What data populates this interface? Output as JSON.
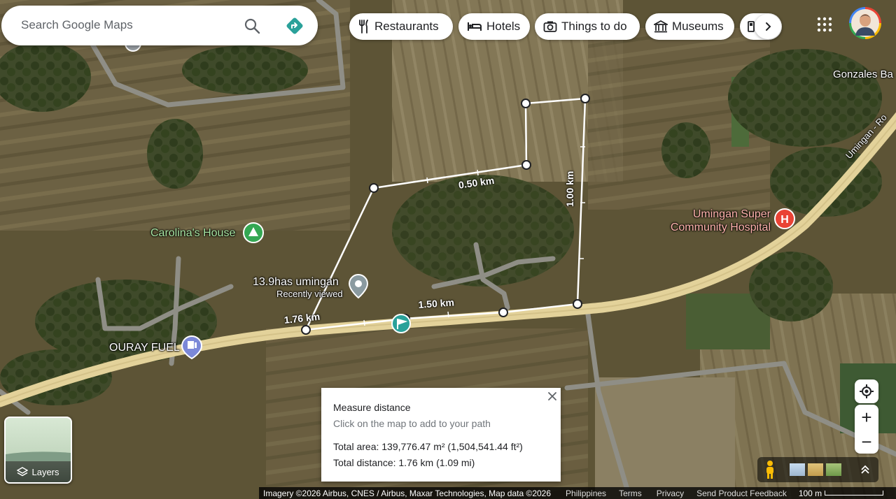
{
  "search": {
    "placeholder": "Search Google Maps"
  },
  "categories": [
    {
      "label": "Restaurants",
      "icon": "fork-knife-icon"
    },
    {
      "label": "Hotels",
      "icon": "bed-icon"
    },
    {
      "label": "Things to do",
      "icon": "camera-icon"
    },
    {
      "label": "Museums",
      "icon": "museum-icon"
    }
  ],
  "places": {
    "gonzales": "Gonzales Ba",
    "umingan_road": "Umingan - Ro",
    "hospital_line1": "Umingan Super",
    "hospital_line2": "Community Hospital",
    "carolina": "Carolina's House",
    "pin_title": "13.9has umingan",
    "pin_subtitle": "Recently viewed",
    "fuel": "OURAY FUEL"
  },
  "segments": {
    "seg1": "0.50 km",
    "seg2": "1.00 km",
    "seg3": "1.50 km",
    "seg4": "1.76 km"
  },
  "measure": {
    "title": "Measure distance",
    "hint": "Click on the map to add to your path",
    "area": "Total area: 139,776.47 m² (1,504,541.44 ft²)",
    "distance": "Total distance: 1.76 km (1.09 mi)"
  },
  "layers": {
    "label": "Layers"
  },
  "zoom": {
    "in": "+",
    "out": "−"
  },
  "footer": {
    "attribution": "Imagery ©2026 Airbus, CNES / Airbus, Maxar Technologies, Map data ©2026",
    "country": "Philippines",
    "terms": "Terms",
    "privacy": "Privacy",
    "feedback": "Send Product Feedback",
    "scale": "100 m"
  },
  "colors": {
    "accent_teal": "#2aa19a",
    "hospital_red": "#ea4335",
    "park_green": "#34a853",
    "road_yellow": "#e3d29a"
  }
}
